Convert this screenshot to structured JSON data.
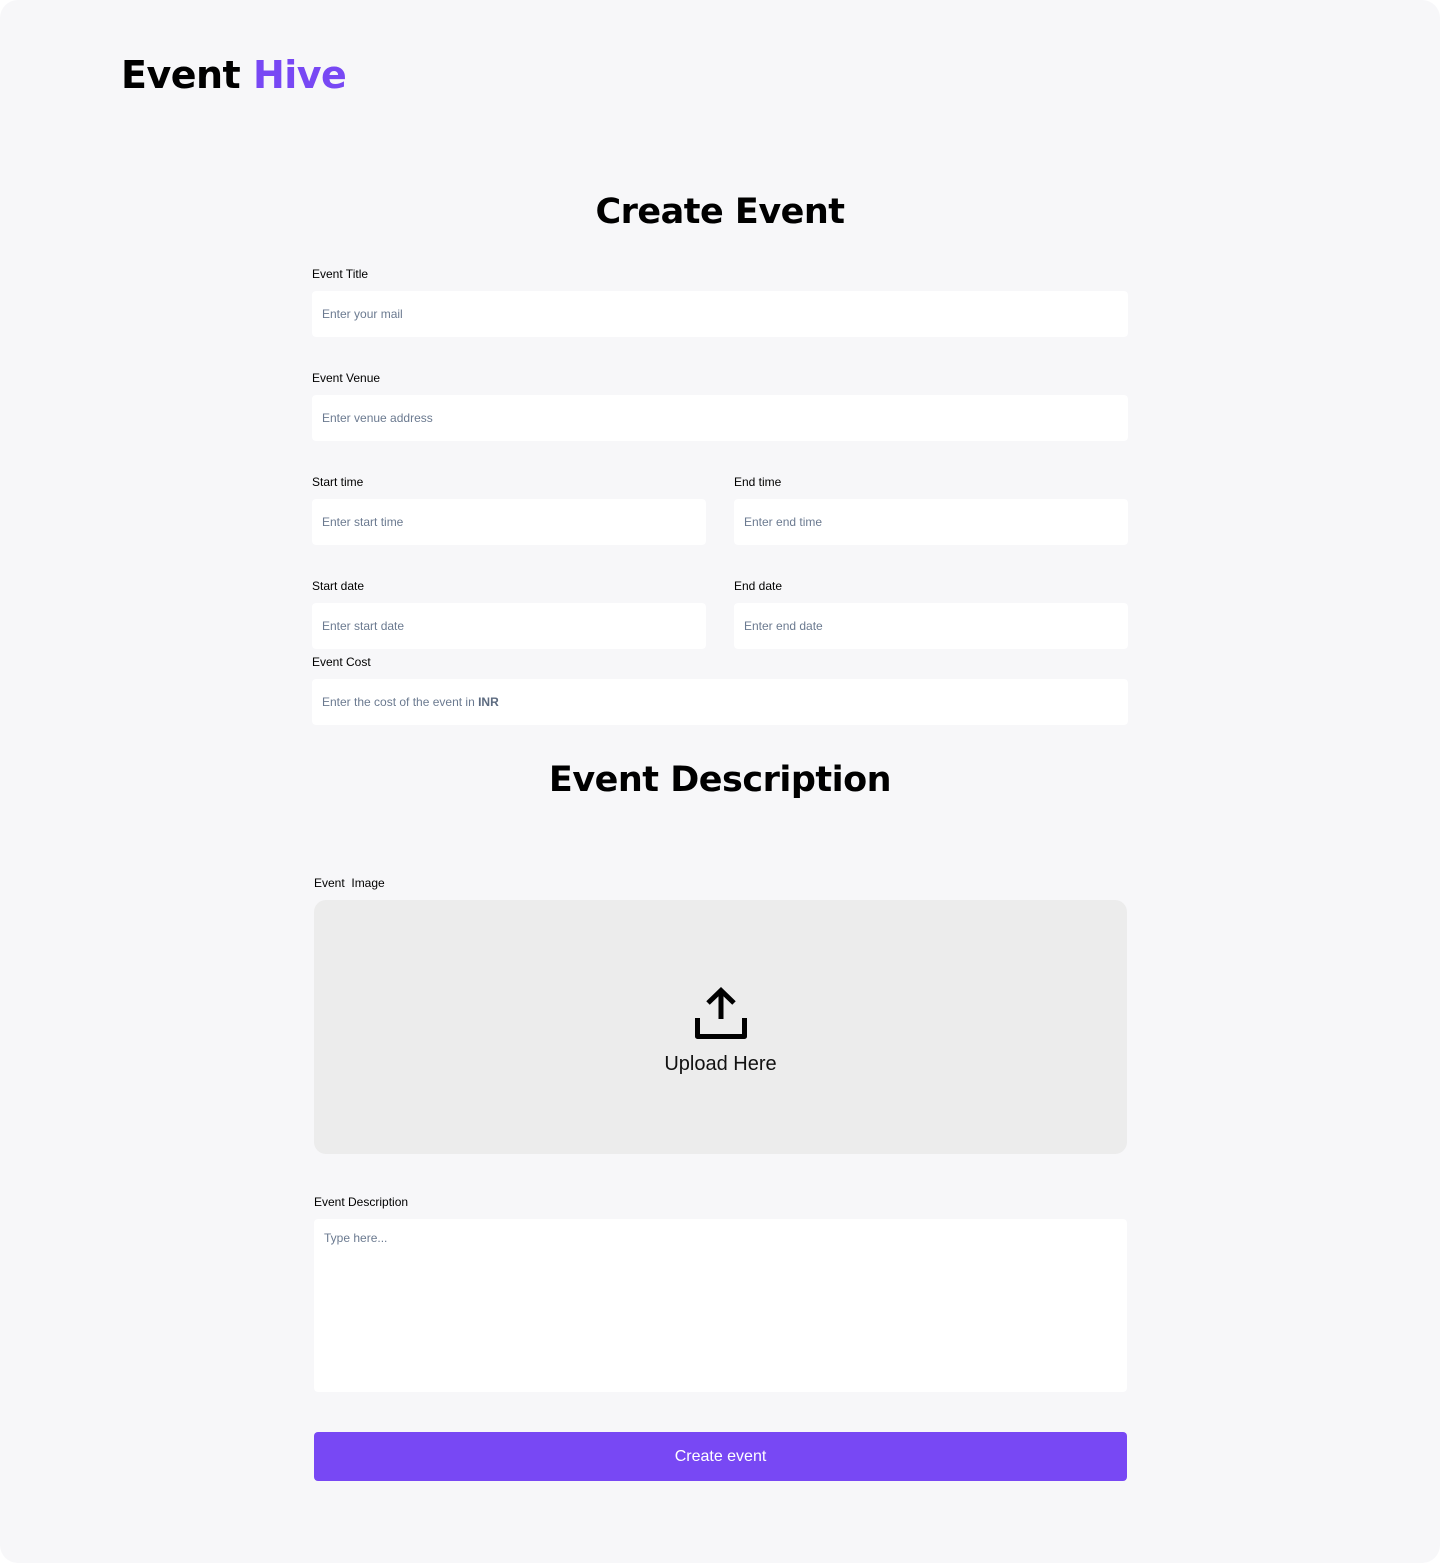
{
  "brand": {
    "name_part1": "Event",
    "name_part2": "Hive",
    "accent_color": "#7848f4"
  },
  "create_event": {
    "heading": "Create Event",
    "title": {
      "label": "Event Title",
      "placeholder": "Enter your mail"
    },
    "venue": {
      "label": "Event Venue",
      "placeholder": "Enter venue address"
    },
    "start_time": {
      "label": "Start time",
      "placeholder": "Enter start time"
    },
    "end_time": {
      "label": "End time",
      "placeholder": "Enter end time"
    },
    "start_date": {
      "label": "Start date",
      "placeholder": "Enter start date"
    },
    "end_date": {
      "label": "End date",
      "placeholder": "Enter end date"
    },
    "cost": {
      "label": "Event Cost",
      "placeholder_prefix": "Enter the cost of the event in ",
      "placeholder_currency": "INR"
    }
  },
  "event_description": {
    "heading": "Event Description",
    "image": {
      "label": "Event  Image",
      "upload_text": "Upload Here",
      "icon": "upload-icon"
    },
    "description": {
      "label": "Event Description",
      "placeholder": "Type here..."
    }
  },
  "submit": {
    "label": "Create event"
  }
}
